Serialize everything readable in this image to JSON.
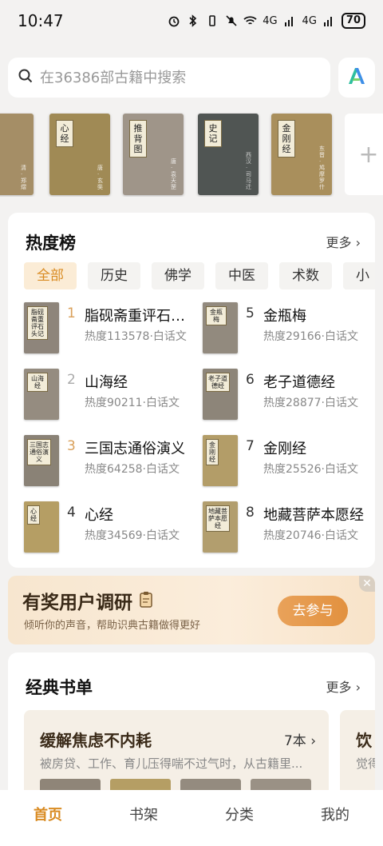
{
  "status": {
    "time": "10:47",
    "battery": "70",
    "net1": "4G",
    "net2": "4G"
  },
  "search": {
    "placeholder": "在36386部古籍中搜索",
    "icon": "search-icon",
    "ai_icon": "ai-logo-icon"
  },
  "carousel": {
    "books": [
      {
        "title": "",
        "author": "清·郑熠",
        "color": "#a58e66"
      },
      {
        "title": "心经",
        "author": "唐·玄奘",
        "color": "#a08a55"
      },
      {
        "title": "推背图",
        "author": "唐·袁天罡",
        "color": "#9f9589"
      },
      {
        "title": "史记",
        "author": "西汉·司马迁",
        "color": "#505553"
      },
      {
        "title": "金刚经",
        "author": "东晋·鸠摩罗什",
        "color": "#a98f5c"
      }
    ],
    "more_icon": "plus-icon"
  },
  "hot": {
    "title": "热度榜",
    "more": "更多",
    "filters": [
      "全部",
      "历史",
      "佛学",
      "中医",
      "术数",
      "小"
    ],
    "items": [
      {
        "rank": "1",
        "title": "脂砚斋重评石头记",
        "meta": "热度113578·白话文",
        "cover_title": "脂砚斋重评石头记",
        "cover_color": "#8e857b"
      },
      {
        "rank": "2",
        "title": "山海经",
        "meta": "热度90211·白话文",
        "cover_title": "山海经",
        "cover_color": "#958c80"
      },
      {
        "rank": "3",
        "title": "三国志通俗演义",
        "meta": "热度64258·白话文",
        "cover_title": "三国志通俗演义",
        "cover_color": "#8a8276"
      },
      {
        "rank": "4",
        "title": "心经",
        "meta": "热度34569·白话文",
        "cover_title": "心经",
        "cover_color": "#b59e64"
      },
      {
        "rank": "5",
        "title": "金瓶梅",
        "meta": "热度29166·白话文",
        "cover_title": "金瓶梅",
        "cover_color": "#928a7e"
      },
      {
        "rank": "6",
        "title": "老子道德经",
        "meta": "热度28877·白话文",
        "cover_title": "老子道德经",
        "cover_color": "#8d8579"
      },
      {
        "rank": "7",
        "title": "金刚经",
        "meta": "热度25526·白话文",
        "cover_title": "金刚经",
        "cover_color": "#b39d68"
      },
      {
        "rank": "8",
        "title": "地藏菩萨本愿经",
        "meta": "热度20746·白话文",
        "cover_title": "地藏菩萨本愿经",
        "cover_color": "#b29e6e"
      }
    ]
  },
  "survey": {
    "title": "有奖用户调研",
    "subtitle": "倾听你的声音，帮助识典古籍做得更好",
    "button": "去参与",
    "close": "✕"
  },
  "booklists": {
    "title": "经典书单",
    "more": "更多",
    "first": {
      "title": "缓解焦虑不内耗",
      "count": "7本",
      "desc": "被房贷、工作、育儿压得喘不过气时，从古籍里..."
    },
    "second": {
      "title": "饮",
      "desc": "觉得"
    }
  },
  "nav": {
    "items": [
      "首页",
      "书架",
      "分类",
      "我的"
    ],
    "active": 0
  },
  "colors": {
    "accent": "#d98b22",
    "background": "#f3f2f1"
  }
}
